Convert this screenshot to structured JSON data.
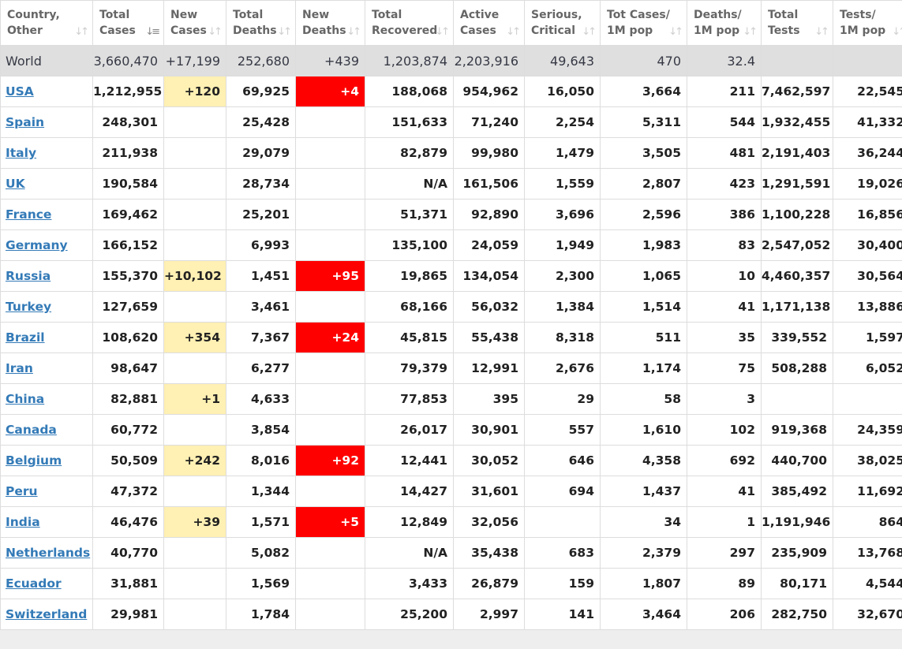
{
  "columns": [
    {
      "label": "Country,\nOther",
      "sort": "both"
    },
    {
      "label": "Total\nCases",
      "sort": "desc"
    },
    {
      "label": "New\nCases",
      "sort": "both"
    },
    {
      "label": "Total\nDeaths",
      "sort": "both"
    },
    {
      "label": "New\nDeaths",
      "sort": "both"
    },
    {
      "label": "Total\nRecovered",
      "sort": "both"
    },
    {
      "label": "Active\nCases",
      "sort": "both"
    },
    {
      "label": "Serious,\nCritical",
      "sort": "both"
    },
    {
      "label": "Tot Cases/\n1M pop",
      "sort": "both"
    },
    {
      "label": "Deaths/\n1M pop",
      "sort": "both"
    },
    {
      "label": "Total\nTests",
      "sort": "both"
    },
    {
      "label": "Tests/\n1M pop",
      "sort": "both"
    }
  ],
  "world": [
    "World",
    "3,660,470",
    "+17,199",
    "252,680",
    "+439",
    "1,203,874",
    "2,203,916",
    "49,643",
    "470",
    "32.4",
    "",
    ""
  ],
  "rows": [
    [
      "USA",
      "1,212,955",
      "+120",
      "69,925",
      "+4",
      "188,068",
      "954,962",
      "16,050",
      "3,664",
      "211",
      "7,462,597",
      "22,545"
    ],
    [
      "Spain",
      "248,301",
      "",
      "25,428",
      "",
      "151,633",
      "71,240",
      "2,254",
      "5,311",
      "544",
      "1,932,455",
      "41,332"
    ],
    [
      "Italy",
      "211,938",
      "",
      "29,079",
      "",
      "82,879",
      "99,980",
      "1,479",
      "3,505",
      "481",
      "2,191,403",
      "36,244"
    ],
    [
      "UK",
      "190,584",
      "",
      "28,734",
      "",
      "N/A",
      "161,506",
      "1,559",
      "2,807",
      "423",
      "1,291,591",
      "19,026"
    ],
    [
      "France",
      "169,462",
      "",
      "25,201",
      "",
      "51,371",
      "92,890",
      "3,696",
      "2,596",
      "386",
      "1,100,228",
      "16,856"
    ],
    [
      "Germany",
      "166,152",
      "",
      "6,993",
      "",
      "135,100",
      "24,059",
      "1,949",
      "1,983",
      "83",
      "2,547,052",
      "30,400"
    ],
    [
      "Russia",
      "155,370",
      "+10,102",
      "1,451",
      "+95",
      "19,865",
      "134,054",
      "2,300",
      "1,065",
      "10",
      "4,460,357",
      "30,564"
    ],
    [
      "Turkey",
      "127,659",
      "",
      "3,461",
      "",
      "68,166",
      "56,032",
      "1,384",
      "1,514",
      "41",
      "1,171,138",
      "13,886"
    ],
    [
      "Brazil",
      "108,620",
      "+354",
      "7,367",
      "+24",
      "45,815",
      "55,438",
      "8,318",
      "511",
      "35",
      "339,552",
      "1,597"
    ],
    [
      "Iran",
      "98,647",
      "",
      "6,277",
      "",
      "79,379",
      "12,991",
      "2,676",
      "1,174",
      "75",
      "508,288",
      "6,052"
    ],
    [
      "China",
      "82,881",
      "+1",
      "4,633",
      "",
      "77,853",
      "395",
      "29",
      "58",
      "3",
      "",
      ""
    ],
    [
      "Canada",
      "60,772",
      "",
      "3,854",
      "",
      "26,017",
      "30,901",
      "557",
      "1,610",
      "102",
      "919,368",
      "24,359"
    ],
    [
      "Belgium",
      "50,509",
      "+242",
      "8,016",
      "+92",
      "12,441",
      "30,052",
      "646",
      "4,358",
      "692",
      "440,700",
      "38,025"
    ],
    [
      "Peru",
      "47,372",
      "",
      "1,344",
      "",
      "14,427",
      "31,601",
      "694",
      "1,437",
      "41",
      "385,492",
      "11,692"
    ],
    [
      "India",
      "46,476",
      "+39",
      "1,571",
      "+5",
      "12,849",
      "32,056",
      "",
      "34",
      "1",
      "1,191,946",
      "864"
    ],
    [
      "Netherlands",
      "40,770",
      "",
      "5,082",
      "",
      "N/A",
      "35,438",
      "683",
      "2,379",
      "297",
      "235,909",
      "13,768"
    ],
    [
      "Ecuador",
      "31,881",
      "",
      "1,569",
      "",
      "3,433",
      "26,879",
      "159",
      "1,807",
      "89",
      "80,171",
      "4,544"
    ],
    [
      "Switzerland",
      "29,981",
      "",
      "1,784",
      "",
      "25,200",
      "2,997",
      "141",
      "3,464",
      "206",
      "282,750",
      "32,670"
    ]
  ],
  "colors": {
    "new_cases_highlight": "#fff0b3",
    "new_deaths_highlight": "#ff0000",
    "link": "#337ab7",
    "world_row": "#dfdfdf"
  }
}
